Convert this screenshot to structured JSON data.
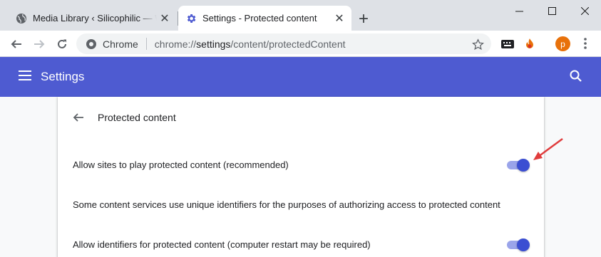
{
  "tabs": [
    {
      "title": "Media Library ‹ Silicophilic — Wo",
      "icon": "globe-icon",
      "active": false
    },
    {
      "title": "Settings - Protected content",
      "icon": "gear-icon",
      "active": true
    }
  ],
  "toolbar": {
    "site_chip": "Chrome",
    "url_scheme": "chrome://",
    "url_host": "settings",
    "url_path": "/content/protectedContent"
  },
  "header": {
    "title": "Settings"
  },
  "subpage": {
    "title": "Protected content",
    "rows": [
      {
        "label": "Allow sites to play protected content (recommended)",
        "toggle": true
      },
      {
        "label": "Some content services use unique identifiers for the purposes of authorizing access to protected content"
      },
      {
        "label": "Allow identifiers for protected content (computer restart may be required)",
        "toggle": true
      }
    ]
  },
  "colors": {
    "header_bg": "#4e5bd1",
    "toggle_on": "#3b4ed2",
    "annotation_arrow": "#e03c3c"
  },
  "profile_initial": "p"
}
